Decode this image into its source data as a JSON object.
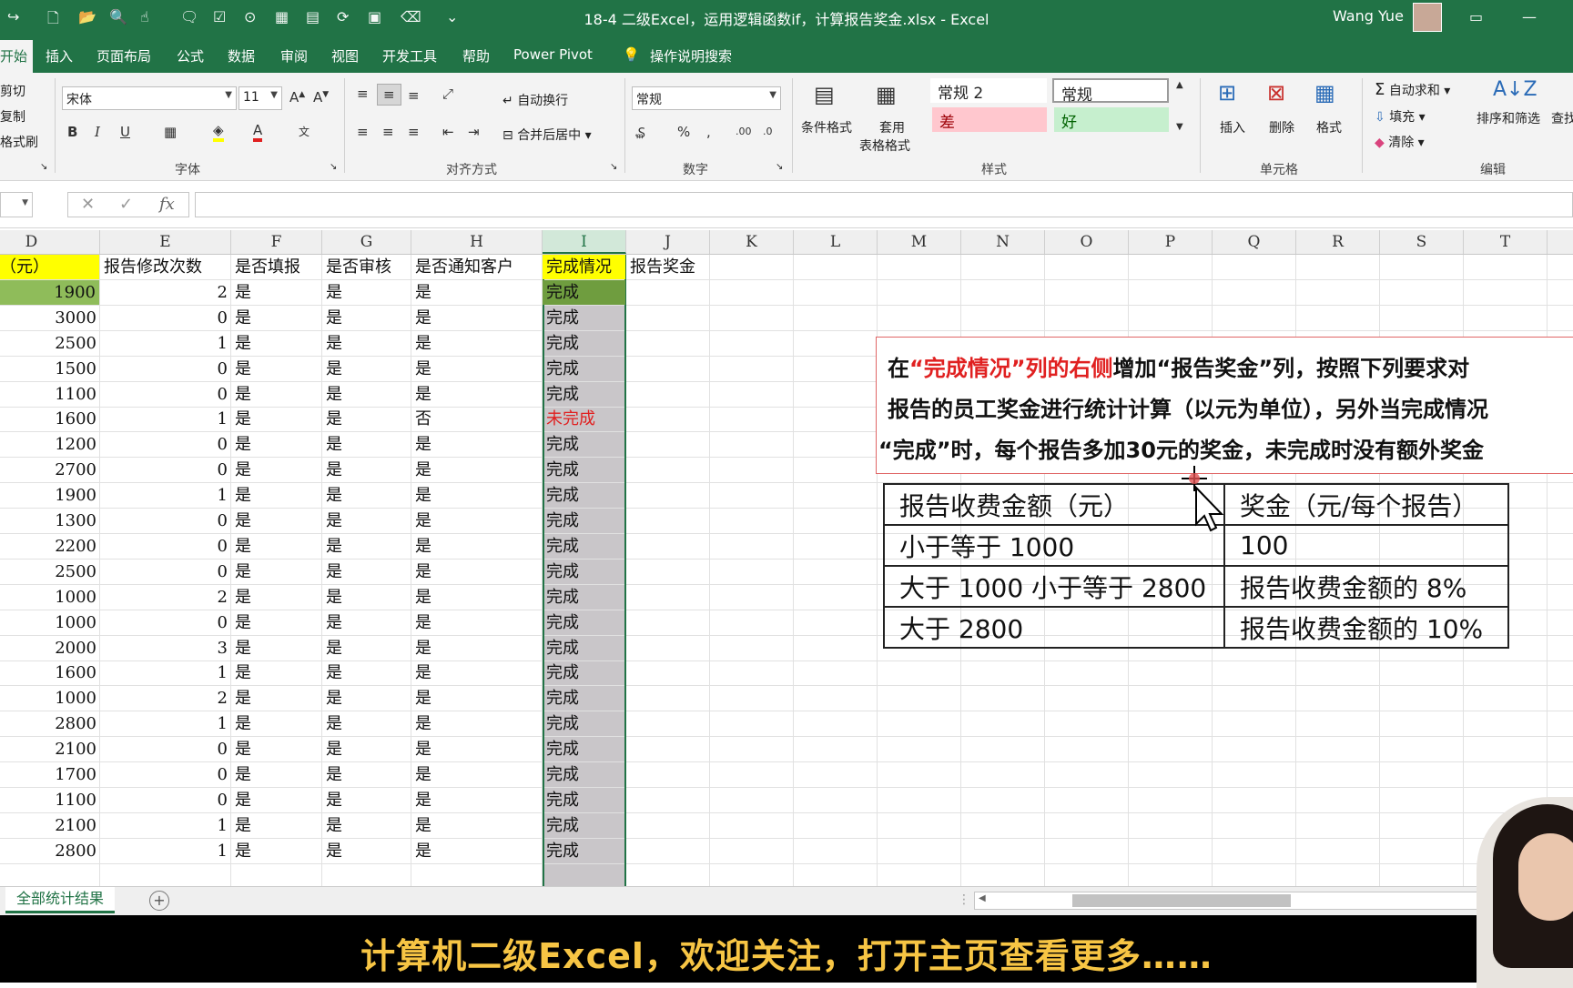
{
  "title_bar": {
    "title": "18-4 二级Excel，运用逻辑函数if，计算报告奖金.xlsx  -  Excel",
    "user": "Wang Yue"
  },
  "ribbon_tabs": [
    "开始",
    "插入",
    "页面布局",
    "公式",
    "数据",
    "审阅",
    "视图",
    "开发工具",
    "帮助",
    "Power Pivot",
    "操作说明搜索"
  ],
  "clipboard": {
    "cut": "剪切",
    "copy": "复制",
    "painter": "格式刷"
  },
  "font_group": {
    "font_name": "宋体",
    "font_size": "11",
    "label": "字体"
  },
  "alignment_group": {
    "wrap": "自动换行",
    "merge": "合并后居中",
    "label": "对齐方式"
  },
  "number_group": {
    "format": "常规",
    "label": "数字"
  },
  "styles_group": {
    "conditional": "条件格式",
    "table_1": "套用",
    "table_2": "表格格式",
    "normal2": "常规 2",
    "normal": "常规",
    "bad": "差",
    "good": "好",
    "label": "样式"
  },
  "cells_group": {
    "insert": "插入",
    "delete": "删除",
    "format": "格式",
    "label": "单元格"
  },
  "editing_group": {
    "autosum": "自动求和",
    "fill": "填充",
    "clear": "清除",
    "sort": "排序和筛选",
    "find": "查找",
    "label": "编辑"
  },
  "formula_bar": {
    "fx": "fx"
  },
  "columns": [
    "D",
    "E",
    "F",
    "G",
    "H",
    "I",
    "J",
    "K",
    "L",
    "M",
    "N",
    "O",
    "P",
    "Q",
    "R",
    "S",
    "T"
  ],
  "headers": {
    "D": "收费（元）",
    "E": "报告修改次数",
    "F": "是否填报",
    "G": "是否审核",
    "H": "是否通知客户",
    "I": "完成情况",
    "J": "报告奖金"
  },
  "rows": [
    {
      "d": "1900",
      "e": "2",
      "f": "是",
      "g": "是",
      "h": "是",
      "i": "完成"
    },
    {
      "d": "3000",
      "e": "0",
      "f": "是",
      "g": "是",
      "h": "是",
      "i": "完成"
    },
    {
      "d": "2500",
      "e": "1",
      "f": "是",
      "g": "是",
      "h": "是",
      "i": "完成"
    },
    {
      "d": "1500",
      "e": "0",
      "f": "是",
      "g": "是",
      "h": "是",
      "i": "完成"
    },
    {
      "d": "1100",
      "e": "0",
      "f": "是",
      "g": "是",
      "h": "是",
      "i": "完成"
    },
    {
      "d": "1600",
      "e": "1",
      "f": "是",
      "g": "是",
      "h": "否",
      "i": "未完成"
    },
    {
      "d": "1200",
      "e": "0",
      "f": "是",
      "g": "是",
      "h": "是",
      "i": "完成"
    },
    {
      "d": "2700",
      "e": "0",
      "f": "是",
      "g": "是",
      "h": "是",
      "i": "完成"
    },
    {
      "d": "1900",
      "e": "1",
      "f": "是",
      "g": "是",
      "h": "是",
      "i": "完成"
    },
    {
      "d": "1300",
      "e": "0",
      "f": "是",
      "g": "是",
      "h": "是",
      "i": "完成"
    },
    {
      "d": "2200",
      "e": "0",
      "f": "是",
      "g": "是",
      "h": "是",
      "i": "完成"
    },
    {
      "d": "2500",
      "e": "0",
      "f": "是",
      "g": "是",
      "h": "是",
      "i": "完成"
    },
    {
      "d": "1000",
      "e": "2",
      "f": "是",
      "g": "是",
      "h": "是",
      "i": "完成"
    },
    {
      "d": "1000",
      "e": "0",
      "f": "是",
      "g": "是",
      "h": "是",
      "i": "完成"
    },
    {
      "d": "2000",
      "e": "3",
      "f": "是",
      "g": "是",
      "h": "是",
      "i": "完成"
    },
    {
      "d": "1600",
      "e": "1",
      "f": "是",
      "g": "是",
      "h": "是",
      "i": "完成"
    },
    {
      "d": "1000",
      "e": "2",
      "f": "是",
      "g": "是",
      "h": "是",
      "i": "完成"
    },
    {
      "d": "2800",
      "e": "1",
      "f": "是",
      "g": "是",
      "h": "是",
      "i": "完成"
    },
    {
      "d": "2100",
      "e": "0",
      "f": "是",
      "g": "是",
      "h": "是",
      "i": "完成"
    },
    {
      "d": "1700",
      "e": "0",
      "f": "是",
      "g": "是",
      "h": "是",
      "i": "完成"
    },
    {
      "d": "1100",
      "e": "0",
      "f": "是",
      "g": "是",
      "h": "是",
      "i": "完成"
    },
    {
      "d": "2100",
      "e": "1",
      "f": "是",
      "g": "是",
      "h": "是",
      "i": "完成"
    },
    {
      "d": "2800",
      "e": "1",
      "f": "是",
      "g": "是",
      "h": "是",
      "i": "完成"
    }
  ],
  "instruction": {
    "l1a": "在",
    "l1b": "“完成情况”列的右侧",
    "l1c": "增加“报告奖金”列，按照下列要求对",
    "l2": "报告的员工奖金进行统计计算（以元为单位），另外当完成情况",
    "l3": "“完成”时，每个报告多加30元的奖金，未完成时没有额外奖金"
  },
  "rule_table": {
    "h1": "报告收费金额（元）",
    "h2": "奖金（元/每个报告）",
    "rows": [
      {
        "a": "小于等于 1000",
        "b": "100"
      },
      {
        "a": "大于 1000 小于等于 2800",
        "b": "报告收费金额的 8%"
      },
      {
        "a": "大于 2800",
        "b": "报告收费金额的 10%"
      }
    ]
  },
  "sheet_tab": "全部统计结果",
  "subtitle": "计算机二级Excel，欢迎关注，打开主页查看更多……",
  "colors": {
    "excel_green": "#217346",
    "header_yellow": "#ffff00",
    "selected_green": "#8fbc5a",
    "column_gray": "#c9c6c9",
    "incomplete_red": "#e02020"
  }
}
